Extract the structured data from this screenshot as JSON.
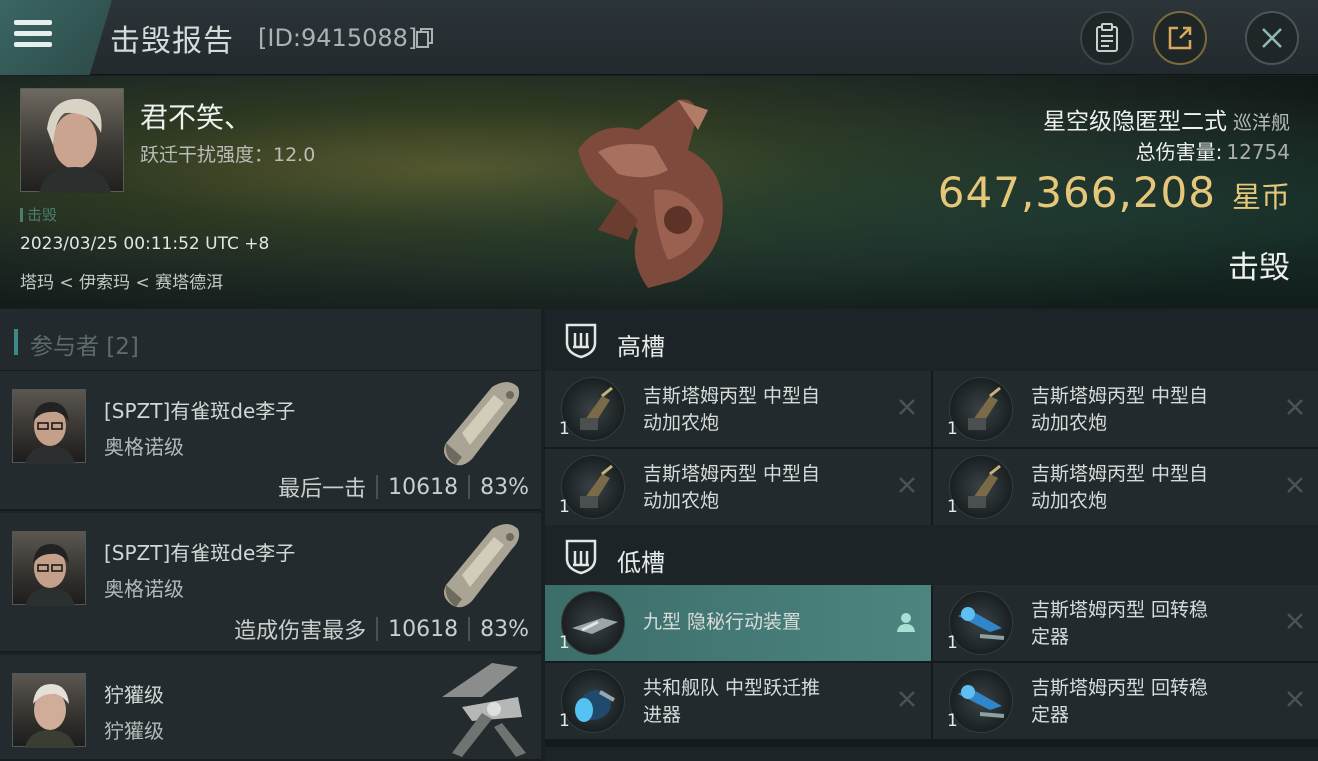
{
  "header": {
    "title": "击毁报告",
    "id_label": "[ID:9415088]"
  },
  "victim": {
    "name": "君不笑、",
    "stat": "跃迁干扰强度：12.0",
    "kill_tag": "击毁",
    "time": "2023/03/25 00:11:52 UTC +8",
    "location": "塔玛 < 伊索玛 < 赛塔德洱",
    "ship_name": "星空级隐匿型二式",
    "ship_class": "巡洋舰",
    "damage_label": "总伤害量:",
    "damage_value": "12754",
    "isk_value": "647,366,208",
    "isk_unit": "星币",
    "status": "击毁"
  },
  "participants": {
    "label": "参与者 [2]",
    "rows": [
      {
        "name": "[SPZT]有雀斑de李子",
        "ship": "奥格诺级",
        "note": "最后一击",
        "damage": "10618",
        "percent": "83%"
      },
      {
        "name": "[SPZT]有雀斑de李子",
        "ship": "奥格诺级",
        "note": "造成伤害最多",
        "damage": "10618",
        "percent": "83%"
      },
      {
        "name": "狞獾级",
        "ship": "狞獾级"
      }
    ]
  },
  "slots": {
    "high": {
      "label": "高槽",
      "items": [
        {
          "l1": "吉斯塔姆丙型 中型自",
          "l2": "动加农炮",
          "qty": "1"
        },
        {
          "l1": "吉斯塔姆丙型 中型自",
          "l2": "动加农炮",
          "qty": "1"
        },
        {
          "l1": "吉斯塔姆丙型 中型自",
          "l2": "动加农炮",
          "qty": "1"
        },
        {
          "l1": "吉斯塔姆丙型 中型自",
          "l2": "动加农炮",
          "qty": "1"
        }
      ]
    },
    "low": {
      "label": "低槽",
      "items": [
        {
          "l1": "九型 隐秘行动装置",
          "l2": "",
          "qty": "1"
        },
        {
          "l1": "吉斯塔姆丙型 回转稳",
          "l2": "定器",
          "qty": "1"
        },
        {
          "l1": "共和舰队 中型跃迁推",
          "l2": "进器",
          "qty": "1"
        },
        {
          "l1": "吉斯塔姆丙型 回转稳",
          "l2": "定器",
          "qty": "1"
        }
      ]
    }
  },
  "colors": {
    "accent": "#3f8a86",
    "isk_gold": "#e6c77a",
    "highlight_row": "#4c8580"
  },
  "icons": [
    "menu-icon",
    "copy-icon",
    "clipboard-icon",
    "share-icon",
    "close-icon",
    "shield-slot-icon",
    "remove-icon",
    "pilot-icon"
  ]
}
